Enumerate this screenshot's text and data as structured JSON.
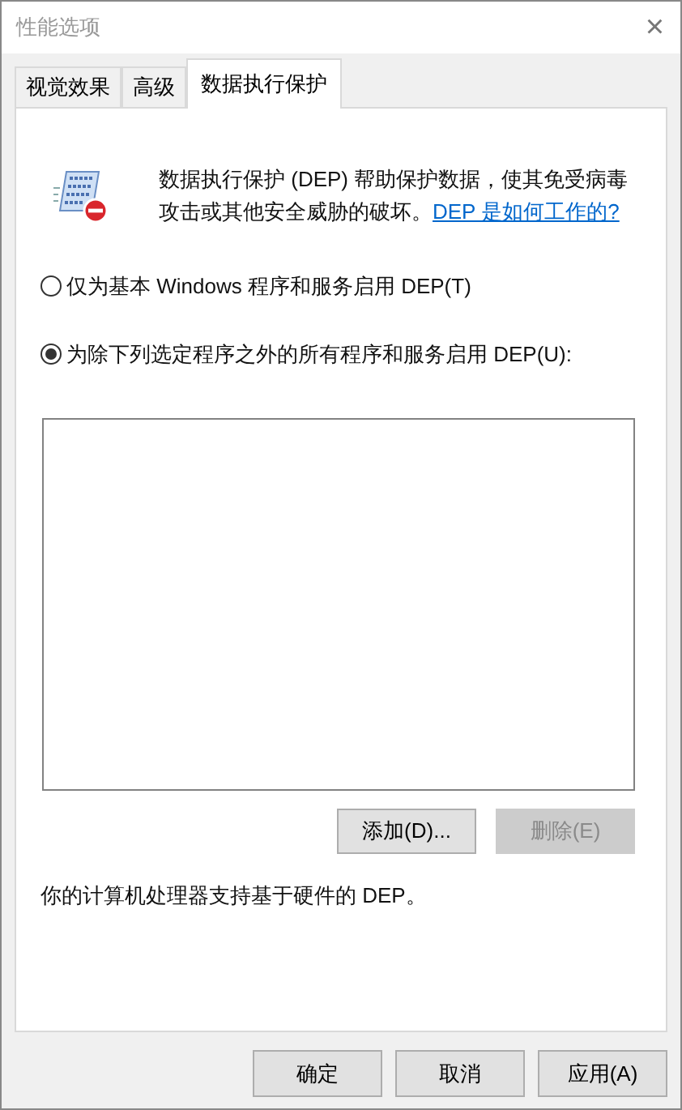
{
  "window": {
    "title": "性能选项",
    "close": "×"
  },
  "tabs": [
    {
      "label": "视觉效果",
      "selected": false
    },
    {
      "label": "高级",
      "selected": false
    },
    {
      "label": "数据执行保护",
      "selected": true
    }
  ],
  "description": {
    "text": "数据执行保护 (DEP) 帮助保护数据，使其免受病毒攻击或其他安全威胁的破坏。",
    "link": "DEP 是如何工作的?"
  },
  "options": [
    {
      "label": "仅为基本 Windows 程序和服务启用 DEP(T)",
      "selected": false
    },
    {
      "label": "为除下列选定程序之外的所有程序和服务启用 DEP(U):",
      "selected": true
    }
  ],
  "list_buttons": [
    {
      "label": "添加(D)...",
      "disabled": false
    },
    {
      "label": "删除(E)",
      "disabled": true
    }
  ],
  "status": "你的计算机处理器支持基于硬件的 DEP。",
  "buttons": [
    {
      "label": "确定",
      "disabled": false
    },
    {
      "label": "取消",
      "disabled": false
    },
    {
      "label": "应用(A)",
      "disabled": false
    }
  ]
}
